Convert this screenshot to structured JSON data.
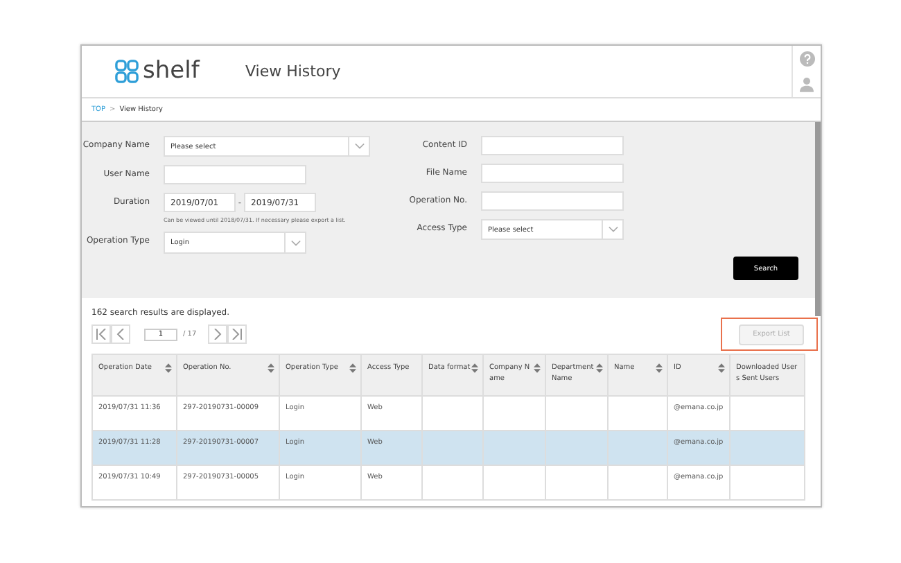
{
  "header": {
    "logo": "shelf",
    "title": "View History"
  },
  "breadcrumb": {
    "items": [
      {
        "label": "TOP",
        "link": true
      },
      {
        "label": "View History",
        "link": false
      }
    ],
    "separator": ">"
  },
  "form": {
    "left": [
      {
        "kind": "select",
        "label": "Company Name",
        "value": "Please select"
      },
      {
        "kind": "text",
        "label": "User Name"
      },
      {
        "kind": "daterange",
        "label": "Duration",
        "from": "2019/07/01",
        "dash": "-",
        "to": "2019/07/31",
        "note": "Can be viewed until 2018/07/31. If necessary please export a list."
      },
      {
        "kind": "select",
        "label": "Operation Type",
        "value": "Login"
      }
    ],
    "right": [
      {
        "kind": "text",
        "label": "Content ID"
      },
      {
        "kind": "text",
        "label": "File Name"
      },
      {
        "kind": "text",
        "label": "Operation No."
      },
      {
        "kind": "select",
        "label": "Access Type",
        "value": "Please select"
      }
    ],
    "search_button": "Search"
  },
  "results": {
    "count_text": "162 search results are displayed.",
    "page": "1",
    "total": "/ 17",
    "export_button": "Export List"
  },
  "table": {
    "columns": [
      {
        "label": "Operation Date",
        "sortable": true
      },
      {
        "label": "Operation No.",
        "sortable": true
      },
      {
        "label": "Operation Type",
        "sortable": true
      },
      {
        "label": "Access Type",
        "sortable": false
      },
      {
        "label": "Data format",
        "sortable": true
      },
      {
        "label": "Company Name",
        "sortable": true
      },
      {
        "label": "Department Name",
        "sortable": true
      },
      {
        "label": "Name",
        "sortable": true
      },
      {
        "label": "ID",
        "sortable": true
      },
      {
        "label": "Downloaded Users Sent Users",
        "sortable": false
      }
    ],
    "rows": [
      {
        "cells": [
          "2019/07/31 11:36",
          "297-20190731-00009",
          "Login",
          "Web",
          "",
          "",
          "",
          "",
          "@emana.co.jp",
          ""
        ]
      },
      {
        "cells": [
          "2019/07/31 11:28",
          "297-20190731-00007",
          "Login",
          "Web",
          "",
          "",
          "",
          "",
          "@emana.co.jp",
          ""
        ]
      },
      {
        "cells": [
          "2019/07/31 10:49",
          "297-20190731-00005",
          "Login",
          "Web",
          "",
          "",
          "",
          "",
          "@emana.co.jp",
          ""
        ]
      }
    ]
  }
}
